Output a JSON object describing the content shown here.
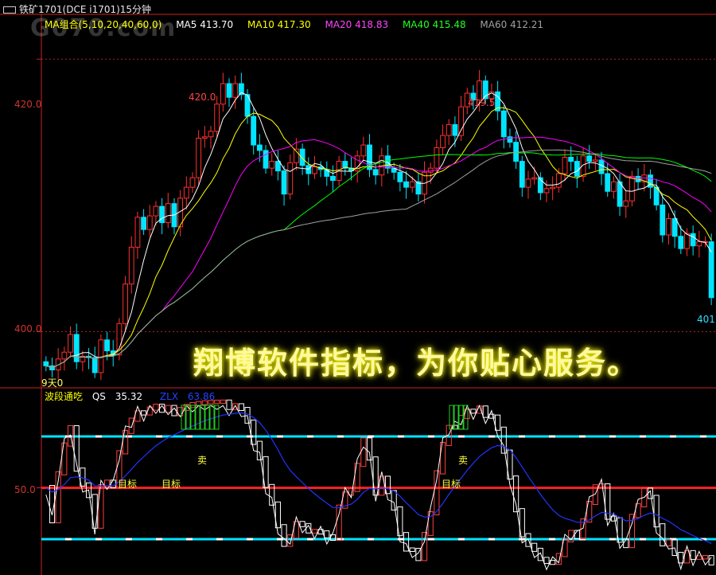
{
  "window": {
    "title": "铁矿1701(DCE i1701)15分钟",
    "watermark": "G070.com"
  },
  "ma_legend": {
    "group_label": "MA组合(5,10,20,40,60,0)",
    "items": [
      {
        "label": "MA5 413.70",
        "color": "#ffffff"
      },
      {
        "label": "MA10 417.30",
        "color": "#ffff00"
      },
      {
        "label": "MA20 418.83",
        "color": "#ff00ff"
      },
      {
        "label": "MA40 415.48",
        "color": "#00ff00"
      },
      {
        "label": "MA60 412.21",
        "color": "#a0a0a0"
      }
    ],
    "group_color": "#ffff00"
  },
  "indicator_legend": {
    "name": "波段通吃",
    "qs_label": "QS",
    "qs_value": "35.32",
    "zlx_label": "ZLX",
    "zlx_value": "63.86"
  },
  "banner": {
    "text": "翔博软件指标，为你贴心服务。"
  },
  "chart_data": [
    {
      "type": "candlestick",
      "ylim": [
        396,
        422
      ],
      "yticks": [
        "420.0",
        "400.0"
      ],
      "peak_labels": [
        "420.0",
        "419.5"
      ],
      "right_edge_label": "401.",
      "left_bottom_label": "9天0",
      "closes": [
        397.5,
        397.2,
        398.0,
        398.5,
        399.8,
        397.8,
        398.2,
        398.1,
        397.0,
        399.4,
        398.6,
        398.3,
        400.6,
        403.5,
        406.2,
        408.4,
        407.5,
        408.5,
        409.2,
        408.0,
        409.4,
        407.7,
        409.8,
        410.6,
        411.3,
        414.2,
        414.3,
        414.7,
        416.7,
        418.2,
        417.2,
        418.2,
        417.4,
        415.8,
        413.7,
        413.3,
        412.0,
        412.5,
        411.8,
        410.1,
        412.4,
        413.4,
        412.2,
        411.6,
        412.1,
        411.9,
        411.4,
        411.1,
        412.5,
        412.0,
        411.8,
        412.9,
        413.7,
        411.9,
        411.5,
        412.9,
        412.0,
        411.7,
        411.0,
        410.6,
        411.0,
        410.1,
        411.7,
        412.0,
        413.5,
        414.4,
        415.2,
        414.4,
        416.5,
        417.5,
        417.0,
        418.4,
        417.1,
        417.6,
        416.2,
        414.3,
        413.9,
        412.5,
        410.6,
        411.2,
        411.3,
        410.2,
        410.5,
        410.6,
        411.6,
        412.8,
        412.5,
        411.4,
        412.9,
        412.5,
        412.6,
        411.6,
        410.3,
        411.0,
        409.2,
        409.6,
        411.4,
        411.0,
        411.5,
        410.6,
        409.3,
        407.1,
        408.3,
        407.0,
        406.1,
        407.2,
        406.3,
        406.6,
        406.6,
        402.5
      ],
      "series": [
        {
          "name": "MA5",
          "color": "#ffffff"
        },
        {
          "name": "MA10",
          "color": "#ffff00"
        },
        {
          "name": "MA20",
          "color": "#ff00ff"
        },
        {
          "name": "MA40",
          "color": "#00ff00"
        },
        {
          "name": "MA60",
          "color": "#a0a0a0"
        }
      ]
    },
    {
      "type": "indicator",
      "ylim": [
        0,
        100
      ],
      "yticks": [
        "50.0"
      ],
      "hlines": [
        {
          "value": 80,
          "color": "#00e5ff"
        },
        {
          "value": 50,
          "color": "#ff2020"
        },
        {
          "value": 20,
          "color": "#00e5ff"
        }
      ],
      "annotations": [
        "目标",
        "目标",
        "卖",
        "目标",
        "卖"
      ],
      "series": [
        {
          "name": "QS",
          "color": "#ffffff"
        },
        {
          "name": "ZLX",
          "color": "#2233ff"
        }
      ]
    }
  ]
}
